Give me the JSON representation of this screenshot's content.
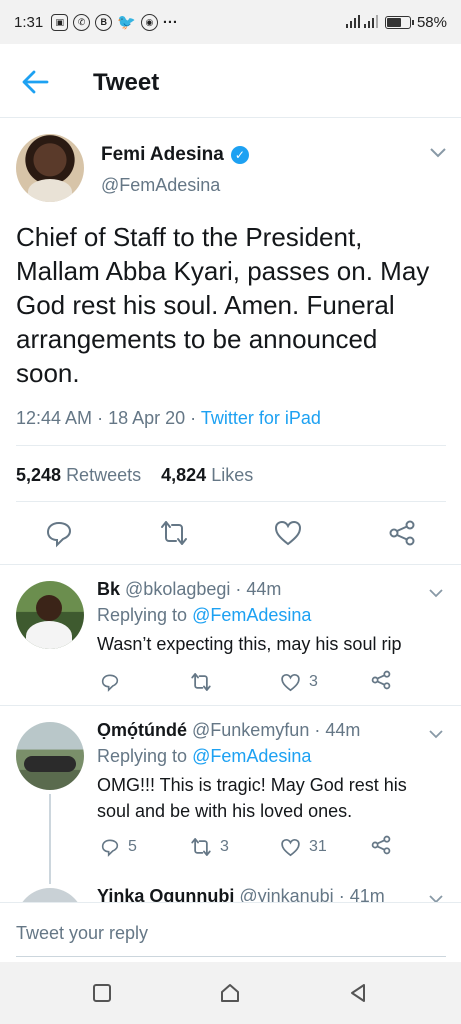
{
  "status_bar": {
    "time": "1:31",
    "battery": "58%",
    "app_icons": [
      "gallery-icon",
      "whatsapp-icon",
      "b-icon",
      "twitter-icon",
      "chrome-icon"
    ],
    "more": "···"
  },
  "header": {
    "title": "Tweet"
  },
  "tweet": {
    "name": "Femi Adesina",
    "handle": "@FemAdesina",
    "text": "Chief of Staff to the President, Mallam Abba Kyari, passes on. May God rest his soul. Amen. Funeral arrangements to be announced soon.",
    "time": "12:44 AM",
    "date": "18 Apr 20",
    "dot": "·",
    "source": "Twitter for iPad",
    "retweets_count": "5,248",
    "retweets_label": "Retweets",
    "likes_count": "4,824",
    "likes_label": "Likes"
  },
  "replies": [
    {
      "name": "Bk",
      "handle": "@bkolagbegi",
      "age": "· 44m",
      "replying_label": "Replying to",
      "replying_to": "@FemAdesina",
      "text": "Wasn’t expecting this, may his soul rip",
      "reply_count": "",
      "retweet_count": "",
      "like_count": "3"
    },
    {
      "name": "Ọmọ́túndé",
      "handle": "@Funkemyfun",
      "age": "· 44m",
      "replying_label": "Replying to",
      "replying_to": "@FemAdesina",
      "text": "OMG!!! This is tragic! May God rest his soul and be with his loved ones.",
      "reply_count": "5",
      "retweet_count": "3",
      "like_count": "31"
    },
    {
      "name": "Yinka Ogunnubi",
      "handle": "@yinkanubi",
      "age": "· 41m"
    }
  ],
  "compose": {
    "placeholder": "Tweet your reply"
  },
  "colors": {
    "accent": "#1da1f2",
    "secondary_text": "#657786",
    "divider": "#e6ecf0"
  }
}
